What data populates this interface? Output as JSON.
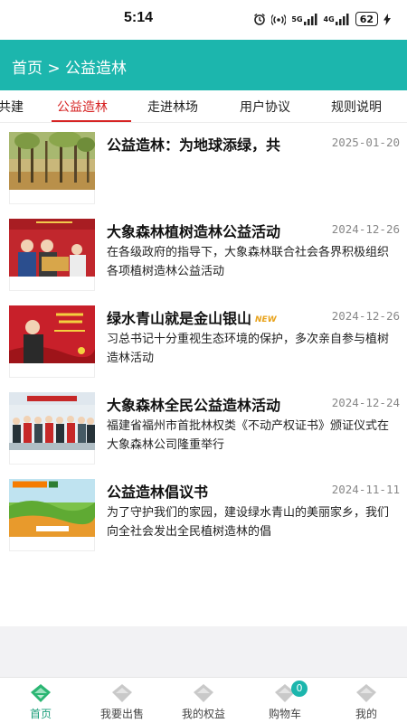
{
  "status_bar": {
    "time": "5:14",
    "battery": "62",
    "net1": "5G",
    "net2": "4G"
  },
  "header": {
    "breadcrumb": "首页 > 公益造林"
  },
  "tabs": [
    {
      "label": "共建",
      "active": false
    },
    {
      "label": "公益造林",
      "active": true
    },
    {
      "label": "走进林场",
      "active": false
    },
    {
      "label": "用户协议",
      "active": false
    },
    {
      "label": "规则说明",
      "active": false
    }
  ],
  "articles": [
    {
      "title": "公益造林：为地球添绿，共",
      "date": "2025-01-20",
      "desc": "",
      "badge": ""
    },
    {
      "title": "大象森林植树造林公益活动",
      "date": "2024-12-26",
      "desc": "在各级政府的指导下，大象森林联合社会各界积极组织各项植树造林公益活动",
      "badge": ""
    },
    {
      "title": "绿水青山就是金山银山",
      "date": "2024-12-26",
      "desc": "习总书记十分重视生态环境的保护，多次亲自参与植树造林活动",
      "badge": "NEW"
    },
    {
      "title": "大象森林全民公益造林活动",
      "date": "2024-12-24",
      "desc": "福建省福州市首批林权类《不动产权证书》颁证仪式在大象森林公司隆重举行",
      "badge": ""
    },
    {
      "title": "公益造林倡议书",
      "date": "2024-11-11",
      "desc": "为了守护我们的家园，建设绿水青山的美丽家乡，我们向全社会发出全民植树造林的倡",
      "badge": ""
    }
  ],
  "bottom_nav": [
    {
      "label": "首页",
      "icon": "home-icon",
      "active": true
    },
    {
      "label": "我要出售",
      "icon": "sell-icon",
      "active": false
    },
    {
      "label": "我的权益",
      "icon": "rights-icon",
      "active": false
    },
    {
      "label": "购物车",
      "icon": "cart-icon",
      "active": false,
      "badge": "0"
    },
    {
      "label": "我的",
      "icon": "profile-icon",
      "active": false
    }
  ],
  "colors": {
    "header": "#1cb6ad",
    "active_tab": "#d62424",
    "nav_active": "#1a9e7a"
  }
}
